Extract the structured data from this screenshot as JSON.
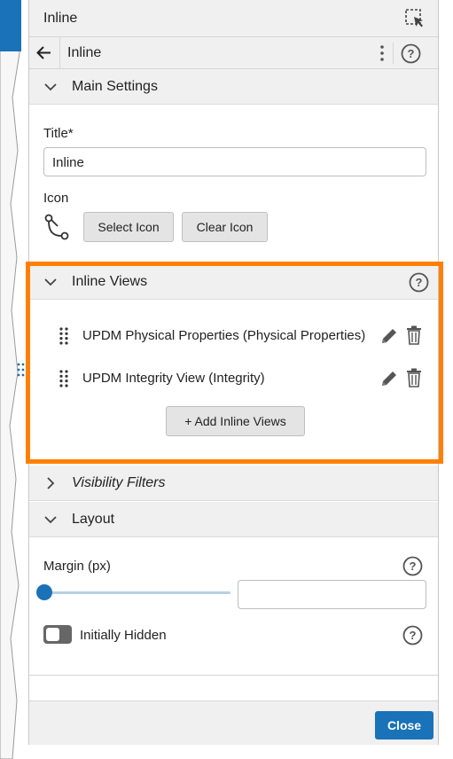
{
  "header": {
    "title": "Inline"
  },
  "subheader": {
    "title": "Inline"
  },
  "main_settings": {
    "heading": "Main Settings",
    "title_label": "Title*",
    "title_value": "Inline",
    "icon_label": "Icon",
    "select_icon": "Select Icon",
    "clear_icon": "Clear Icon"
  },
  "inline_views": {
    "heading": "Inline Views",
    "items": [
      {
        "label": "UPDM Physical Properties (Physical Properties)"
      },
      {
        "label": "UPDM Integrity View (Integrity)"
      }
    ],
    "add_button": "+ Add Inline Views"
  },
  "visibility_filters": {
    "heading": "Visibility Filters"
  },
  "layout": {
    "heading": "Layout",
    "margin_label": "Margin (px)",
    "margin_value": "",
    "margin_slider_fraction": 0,
    "initially_hidden_label": "Initially Hidden",
    "initially_hidden_on": false
  },
  "footer": {
    "close": "Close"
  },
  "colors": {
    "accent": "#1a72b8",
    "highlight": "#ff8000",
    "section_bg": "#f0f0f0"
  }
}
